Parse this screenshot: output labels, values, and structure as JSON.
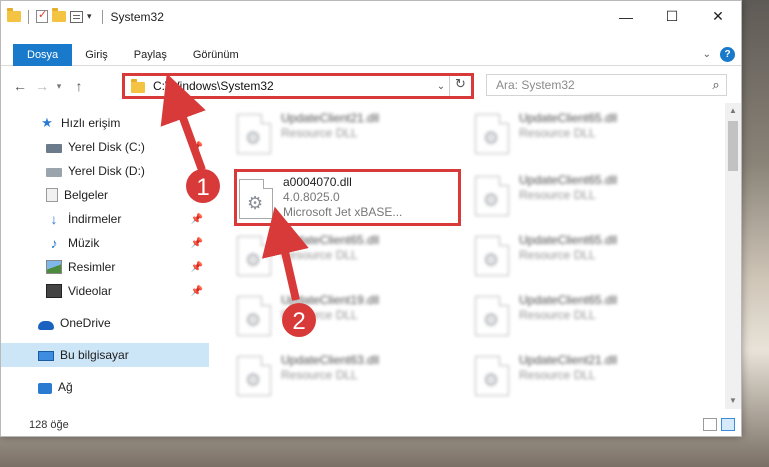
{
  "window": {
    "title": "System32",
    "controls": {
      "minimize": "—",
      "maximize": "☐",
      "close": "✕"
    }
  },
  "ribbon": {
    "tabs": [
      {
        "label": "Dosya",
        "active": true
      },
      {
        "label": "Giriş"
      },
      {
        "label": "Paylaş"
      },
      {
        "label": "Görünüm"
      }
    ],
    "help": "?"
  },
  "nav": {
    "address": "C:\\Windows\\System32",
    "search_placeholder": "Ara: System32"
  },
  "sidebar": {
    "items": [
      {
        "label": "Hızlı erişim",
        "icon": "star-icon"
      },
      {
        "label": "Yerel Disk (C:)",
        "icon": "drive-icon",
        "pinned": true
      },
      {
        "label": "Yerel Disk (D:)",
        "icon": "drive-icon"
      },
      {
        "label": "Belgeler",
        "icon": "documents-icon"
      },
      {
        "label": "İndirmeler",
        "icon": "downloads-icon",
        "pinned": true
      },
      {
        "label": "Müzik",
        "icon": "music-icon",
        "pinned": true
      },
      {
        "label": "Resimler",
        "icon": "pictures-icon",
        "pinned": true
      },
      {
        "label": "Videolar",
        "icon": "videos-icon",
        "pinned": true
      },
      {
        "label": "OneDrive",
        "icon": "onedrive-icon"
      },
      {
        "label": "Bu bilgisayar",
        "icon": "this-pc-icon",
        "selected": true
      },
      {
        "label": "Ağ",
        "icon": "network-icon"
      }
    ]
  },
  "files": {
    "left": [
      {
        "name": "UpdateClient21.dll",
        "type": "Resource DLL"
      },
      {
        "name": "a0004070.dll",
        "version": "4.0.8025.0",
        "description": "Microsoft Jet xBASE...",
        "highlighted": true
      },
      {
        "name": "UpdateClient65.dll",
        "type": "Resource DLL"
      },
      {
        "name": "UpdateClient19.dll",
        "type": "Resource DLL"
      },
      {
        "name": "UpdateClient63.dll",
        "type": "Resource DLL"
      }
    ],
    "right": [
      {
        "name": "UpdateClient65.dll",
        "type": "Resource DLL"
      },
      {
        "name": "UpdateClient65.dll",
        "type": "Resource DLL"
      },
      {
        "name": "UpdateClient65.dll",
        "type": "Resource DLL"
      },
      {
        "name": "UpdateClient65.dll",
        "type": "Resource DLL"
      },
      {
        "name": "UpdateClient21.dll",
        "type": "Resource DLL"
      }
    ]
  },
  "status": {
    "count": "128 öğe"
  },
  "annotations": {
    "step1": "1",
    "step2": "2",
    "color": "#d83a3a"
  }
}
